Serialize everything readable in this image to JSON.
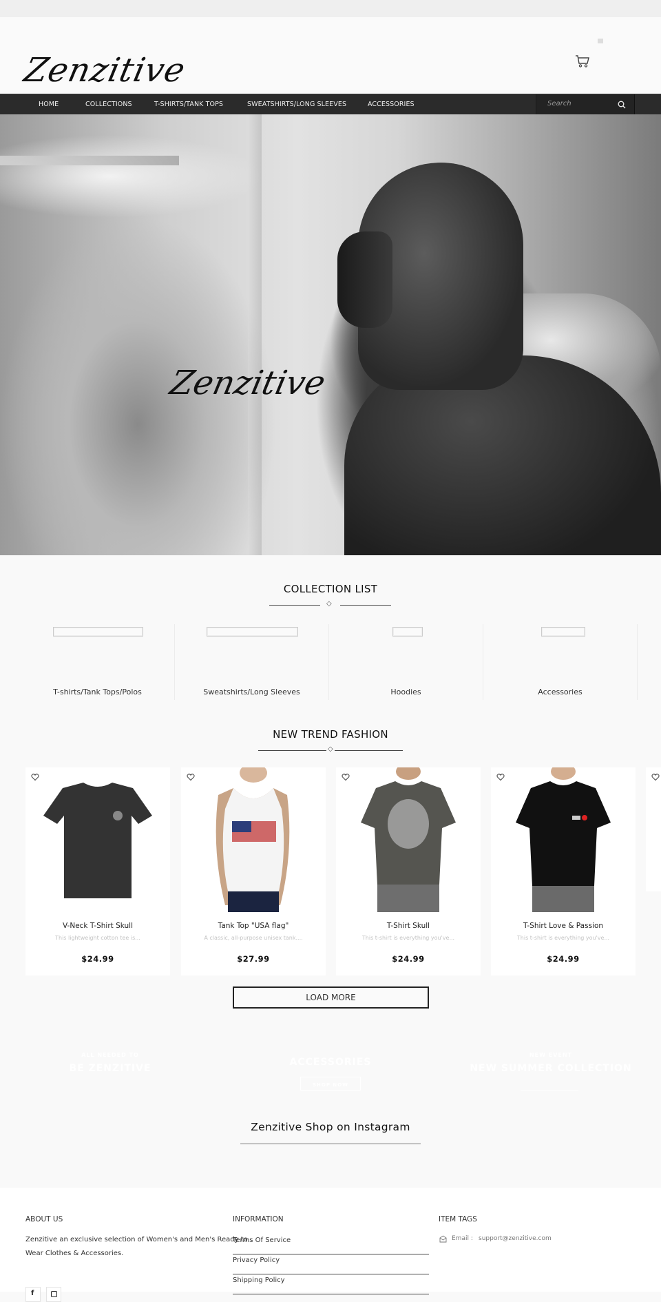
{
  "header": {
    "logo_text": "Zenzitive",
    "cart_icon": "cart-icon"
  },
  "nav": {
    "items": [
      {
        "label": "HOME"
      },
      {
        "label": "COLLECTIONS"
      },
      {
        "label": "T-SHIRTS/TANK TOPS"
      },
      {
        "label": "SWEATSHIRTS/LONG SLEEVES"
      },
      {
        "label": "ACCESSORIES"
      }
    ],
    "search_placeholder": "Search",
    "search_icon": "search-icon"
  },
  "hero": {
    "logo_text": "Zenzitive"
  },
  "collection_list": {
    "title": "COLLECTION LIST",
    "items": [
      {
        "label": "T-shirts/Tank Tops/Polos"
      },
      {
        "label": "Sweatshirts/Long Sleeves"
      },
      {
        "label": "Hoodies"
      },
      {
        "label": "Accessories"
      }
    ]
  },
  "new_trend": {
    "title": "NEW TREND FASHION",
    "products": [
      {
        "name": "V-Neck T-Shirt Skull",
        "description": "This lightweight cotton tee is...",
        "price": "$24.99"
      },
      {
        "name": "Tank Top \"USA flag\"",
        "description": "A classic, all-purpose unisex tank....",
        "price": "$27.99"
      },
      {
        "name": "T-Shirt Skull",
        "description": "This t-shirt is everything you've...",
        "price": "$24.99"
      },
      {
        "name": "T-Shirt Love & Passion",
        "description": "This t-shirt is everything you've...",
        "price": "$24.99"
      }
    ],
    "load_more_label": "LOAD MORE"
  },
  "banners": {
    "left": {
      "subtitle": "ALL NEEDED TO",
      "title": "BE ZENZITIVE"
    },
    "center": {
      "title": "ACCESSORIES",
      "button_label": "SHOP NOW"
    },
    "right": {
      "subtitle": "NEW EVENT",
      "title": "NEW SUMMER COLLECTION"
    }
  },
  "instagram": {
    "title": "Zenzitive Shop on Instagram"
  },
  "footer": {
    "about": {
      "heading": "ABOUT US",
      "text_line1": "Zenzitive an exclusive selection of Women's and Men's Ready to",
      "text_line2": "Wear Clothes & Accessories."
    },
    "information": {
      "heading": "INFORMATION",
      "links": [
        {
          "label": "Terms Of Service"
        },
        {
          "label": "Privacy Policy"
        },
        {
          "label": "Shipping Policy"
        }
      ]
    },
    "item_tags": {
      "heading": "ITEM TAGS",
      "email_label": "Email :",
      "email_value": "support@zenzitive.com"
    },
    "social": [
      {
        "icon": "facebook-icon"
      },
      {
        "icon": "instagram-icon"
      }
    ]
  },
  "colors": {
    "nav_bg": "#2b2b2b",
    "page_bg": "#f9f9f9",
    "text_dark": "#111111"
  }
}
